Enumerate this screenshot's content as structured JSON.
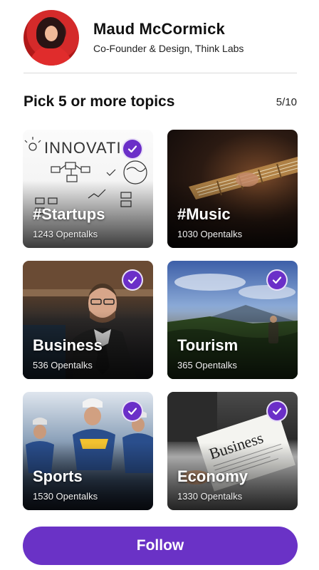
{
  "profile": {
    "name": "Maud McCormick",
    "role": "Co-Founder & Design, Think Labs"
  },
  "topics": {
    "title": "Pick 5 or more topics",
    "count": "5/10",
    "items": [
      {
        "label": "#Startups",
        "count": "1243 Opentalks",
        "selected": true,
        "sketch_text": "INNOVATIO"
      },
      {
        "label": "#Music",
        "count": "1030 Opentalks",
        "selected": false
      },
      {
        "label": "Business",
        "count": "536 Opentalks",
        "selected": true
      },
      {
        "label": "Tourism",
        "count": "365 Opentalks",
        "selected": true
      },
      {
        "label": "Sports",
        "count": "1530 Opentalks",
        "selected": true
      },
      {
        "label": "Economy",
        "count": "1330 Opentalks",
        "selected": true,
        "newspaper_text": "Business"
      }
    ]
  },
  "actions": {
    "follow_label": "Follow"
  },
  "colors": {
    "accent": "#6a32c6"
  },
  "icons": {
    "check": "checkmark-icon"
  }
}
